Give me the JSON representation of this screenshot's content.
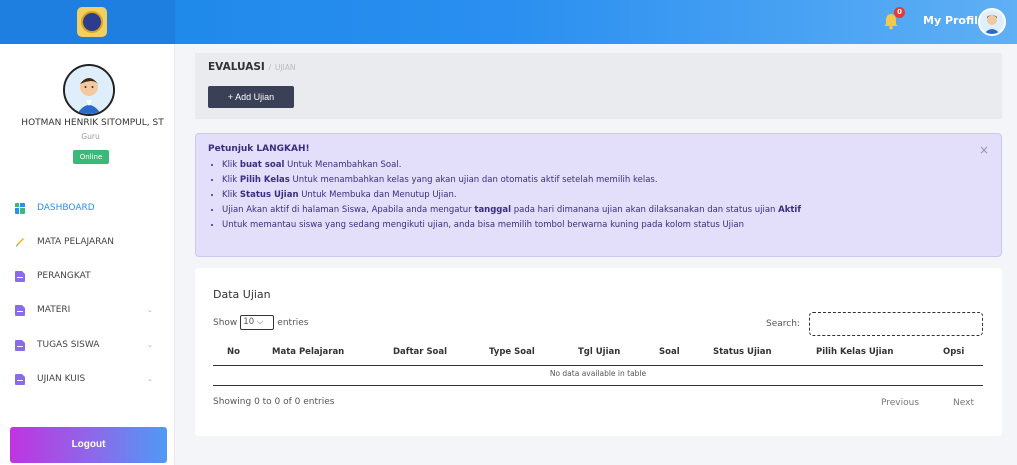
{
  "topbar": {
    "notification_count": "0",
    "profile_label": "My Profile"
  },
  "sidebar": {
    "user_name": "HOTMAN HENRIK SITOMPUL, ST",
    "user_role": "Guru",
    "status": "Online",
    "items": [
      {
        "label": "DASHBOARD",
        "icon": "dashboard-icon",
        "color": "#3cb878"
      },
      {
        "label": "MATA PELAJARAN",
        "icon": "pencil-icon",
        "color": "#f0b400"
      },
      {
        "label": "PERANGKAT",
        "icon": "file-icon",
        "color": "#8a6bea"
      },
      {
        "label": "MATERI",
        "icon": "file-icon",
        "color": "#8a6bea"
      },
      {
        "label": "TUGAS SISWA",
        "icon": "file-icon",
        "color": "#8a6bea"
      },
      {
        "label": "UJIAN KUIS",
        "icon": "file-icon",
        "color": "#8a6bea"
      }
    ],
    "logout_label": "Logout"
  },
  "header": {
    "title": "EVALUASI",
    "separator": "/",
    "subtitle": "UJIAN",
    "add_button": "+ Add Ujian"
  },
  "alert": {
    "title": "Petunjuk LANGKAH!",
    "close": "×",
    "items": [
      {
        "pre": "Klik ",
        "bold": "buat soal",
        "post": " Untuk Menambahkan Soal."
      },
      {
        "pre": "Klik ",
        "bold": "Pilih Kelas",
        "post": " Untuk menambahkan kelas yang akan ujian dan otomatis aktif setelah memilih kelas."
      },
      {
        "pre": "Klik ",
        "bold": "Status Ujian",
        "post": " Untuk Membuka dan Menutup Ujian."
      },
      {
        "pre": "Ujian Akan aktif di halaman Siswa, Apabila anda mengatur ",
        "bold": "tanggal",
        "post": " pada hari dimanana ujian akan dilaksanakan dan status ujian ",
        "bold2": "Aktif"
      },
      {
        "pre": "Untuk memantau siswa yang sedang mengikuti ujian, anda bisa memilih tombol berwarna kuning pada kolom status Ujian",
        "bold": "",
        "post": ""
      }
    ]
  },
  "table": {
    "title": "Data Ujian",
    "show_label": "Show",
    "page_size": "10",
    "entries_label": "entries",
    "search_label": "Search:",
    "columns": [
      "No",
      "Mata Pelajaran",
      "Daftar Soal",
      "Type Soal",
      "Tgl Ujian",
      "Soal",
      "Status Ujian",
      "Pilih Kelas Ujian",
      "Opsi"
    ],
    "empty_message": "No data available in table",
    "info": "Showing 0 to 0 of 0 entries",
    "previous": "Previous",
    "next": "Next"
  }
}
